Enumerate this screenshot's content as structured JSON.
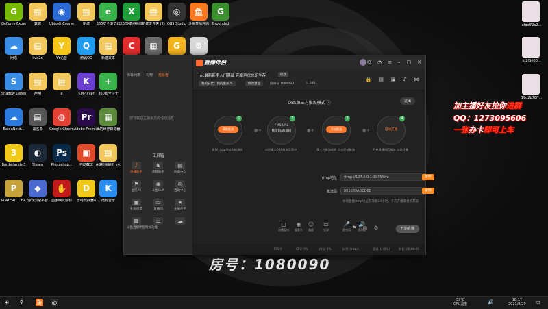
{
  "wallpaper": {
    "room_number": "房号：1080090"
  },
  "desktop": {
    "icons": [
      {
        "label": "GeForce Experience",
        "color": "#76b900",
        "glyph": "G"
      },
      {
        "label": "数据",
        "color": "#f2c75c",
        "glyph": "▤"
      },
      {
        "label": "Ubisoft Connect",
        "color": "#2a6bd6",
        "glyph": "◉"
      },
      {
        "label": "新建",
        "color": "#f2c75c",
        "glyph": "▤"
      },
      {
        "label": "360安全浏览器",
        "color": "#38b44a",
        "glyph": "e"
      },
      {
        "label": "XBOX鑫存图库",
        "color": "#1f9e3a",
        "glyph": "X"
      },
      {
        "label": "新建文件夹 (2)",
        "color": "#f2c75c",
        "glyph": "▤"
      },
      {
        "label": "OBS Studio",
        "color": "#333333",
        "glyph": "◎"
      },
      {
        "label": "斗鱼直播伴侣",
        "color": "#ff7a1f",
        "glyph": "鱼"
      },
      {
        "label": "Grounded",
        "color": "#3c8f2f",
        "glyph": "G"
      },
      {
        "label": "网络",
        "color": "#3a8ee6",
        "glyph": "☁"
      },
      {
        "label": "live2d",
        "color": "#f2c75c",
        "glyph": "▤"
      },
      {
        "label": "YY语音",
        "color": "#f5c518",
        "glyph": "Y"
      },
      {
        "label": "腾讯QQ",
        "color": "#1f9bf0",
        "glyph": "Q"
      },
      {
        "label": "新建文本",
        "color": "#f2c75c",
        "glyph": "▤"
      },
      {
        "label": "CCleaner",
        "color": "#e02e2e",
        "glyph": "C"
      },
      {
        "label": "LOL",
        "color": "#6a6a6a",
        "glyph": "▦"
      },
      {
        "label": "",
        "color": "#f3b51d",
        "glyph": "G"
      },
      {
        "label": "",
        "color": "#d8d8d8",
        "glyph": "⚙"
      },
      {
        "label": "Shadow Defender",
        "color": "#3a8ee6",
        "glyph": "S"
      },
      {
        "label": "声明",
        "color": "#f2c75c",
        "glyph": "▤"
      },
      {
        "label": "e",
        "color": "#f2c75c",
        "glyph": "▤"
      },
      {
        "label": "KMPlayer",
        "color": "#6a3fd0",
        "glyph": "K"
      },
      {
        "label": "360安全卫士",
        "color": "#38b44a",
        "glyph": "+"
      },
      {
        "label": "BaiduNetd...",
        "color": "#2a7ae0",
        "glyph": "☁"
      },
      {
        "label": "黑名单",
        "color": "#555555",
        "glyph": "▤"
      },
      {
        "label": "Google Chrome",
        "color": "#e34133",
        "glyph": "◍"
      },
      {
        "label": "Adobe Premie...",
        "color": "#2a0a4a",
        "glyph": "Pr"
      },
      {
        "label": "我的世界启动器",
        "color": "#5a8a3a",
        "glyph": "▦"
      },
      {
        "label": "Borderlands 3",
        "color": "#f0c818",
        "glyph": "3"
      },
      {
        "label": "Steam",
        "color": "#1b2838",
        "glyph": "◐"
      },
      {
        "label": "Photoshop...",
        "color": "#0a2a4a",
        "glyph": "Ps"
      },
      {
        "label": "自助截屏",
        "color": "#e04a2a",
        "glyph": "▣"
      },
      {
        "label": "AG视频解析 v4.19永久版",
        "color": "#f2c75c",
        "glyph": "▤"
      },
      {
        "label": "PLAYERU... BATTLEGR...",
        "color": "#c8a23a",
        "glyph": "P"
      },
      {
        "label": "游戏加速平台",
        "color": "#4a6ad0",
        "glyph": "◆"
      },
      {
        "label": "血手幽灵鼠标",
        "color": "#c01a1a",
        "glyph": "✋"
      },
      {
        "label": "雷电模拟器4",
        "color": "#f0c818",
        "glyph": "D"
      },
      {
        "label": "酷狗音乐",
        "color": "#2a8ef0",
        "glyph": "K"
      }
    ]
  },
  "promo": {
    "line1a": "加主播好友拉你",
    "line1b": "进群",
    "line2": "QQ：1273095606",
    "line3a": "一张",
    "line3b": "办卡",
    "line3c": "即可上车"
  },
  "right_thumbs": [
    {
      "label": "afdd72a2..."
    },
    {
      "label": "fd2f5000..."
    },
    {
      "label": "19d2b78ff..."
    }
  ],
  "app": {
    "logo_text": "直播伴侣",
    "left_tabs": [
      "弹幕列表",
      "礼物",
      "观看者"
    ],
    "left_message": "您有欢迎主播会员的活动消息！",
    "tools_title": "工具箱",
    "tools": [
      {
        "label": "弹幕助手",
        "glyph": "♪"
      },
      {
        "label": "房管助手",
        "glyph": "♞"
      },
      {
        "label": "数据中心",
        "glyph": "▤"
      },
      {
        "label": "全民PK",
        "glyph": "⚑"
      },
      {
        "label": "斗鱼Buff",
        "glyph": "◉"
      },
      {
        "label": "活动中心",
        "glyph": "◎"
      },
      {
        "label": "礼物投票",
        "glyph": "▣"
      },
      {
        "label": "直播间",
        "glyph": "▭"
      },
      {
        "label": "主播任务",
        "glyph": "★"
      },
      {
        "label": "斗鱼直播伴侣附加功能",
        "glyph": "▦"
      },
      {
        "label": "",
        "glyph": "☰"
      },
      {
        "label": "",
        "glyph": "☁"
      }
    ],
    "room": {
      "title": "mc最新新手入门基础 宪章声优总乐生存",
      "modify": "修改",
      "category_prefix": "我的分类：",
      "category": "我的生存",
      "edit_cover": "修改封面",
      "room_label": "房间号",
      "room_number": "1080090",
      "hot_count": "186"
    },
    "mode_title": "OBS第三方推流模式",
    "exit_label": "退出",
    "steps": [
      {
        "num": "1",
        "label": "获取推流",
        "caption": "复制 rtmp地址和推流码"
      },
      {
        "num": "2",
        "label": "FMS URL\n推流码/串流码",
        "caption": "对应填入OBS推流设置中"
      },
      {
        "num": "3",
        "label": "开始推流",
        "caption": "第三方推流软件 点击开始推流"
      },
      {
        "num": "4",
        "label": "自动开播",
        "caption": "开启直播间后推流 自动开播"
      }
    ],
    "rtmp_label": "rtmp地址",
    "rtmp_value": "rtmp://127.0.0.1:1935/live",
    "key_label": "推流码",
    "key_value": "001089ADCDEE",
    "copy_label": "复制",
    "note": "本场直播rtmp地址有效期24小时，下次开播需重新获取",
    "bottom_buttons": [
      {
        "label": "直播窗口",
        "glyph": "▢"
      },
      {
        "label": "摄像头",
        "glyph": "◉"
      },
      {
        "label": "美颜",
        "glyph": "☺"
      },
      {
        "label": "全屏",
        "glyph": "▭"
      },
      {
        "label": "麦克风",
        "glyph": "🎤"
      },
      {
        "label": "扬声器",
        "glyph": "🔊"
      },
      {
        "label": "",
        "glyph": "⚑"
      },
      {
        "label": "",
        "glyph": "◎"
      },
      {
        "label": "",
        "glyph": "⚙"
      }
    ],
    "start_label": "开始直播",
    "status": {
      "fps": "FPS:0",
      "cpu": "CPU: 9%",
      "mem": "内存: 4%",
      "net": "码率: 0 kb/s",
      "drop": "丢帧: 0 (0%)",
      "time": "时长: 00:00:00"
    }
  },
  "taskbar": {
    "temp": "39°C",
    "temp_label": "CPU温度",
    "time": "18:17",
    "date": "2021/8/29"
  }
}
